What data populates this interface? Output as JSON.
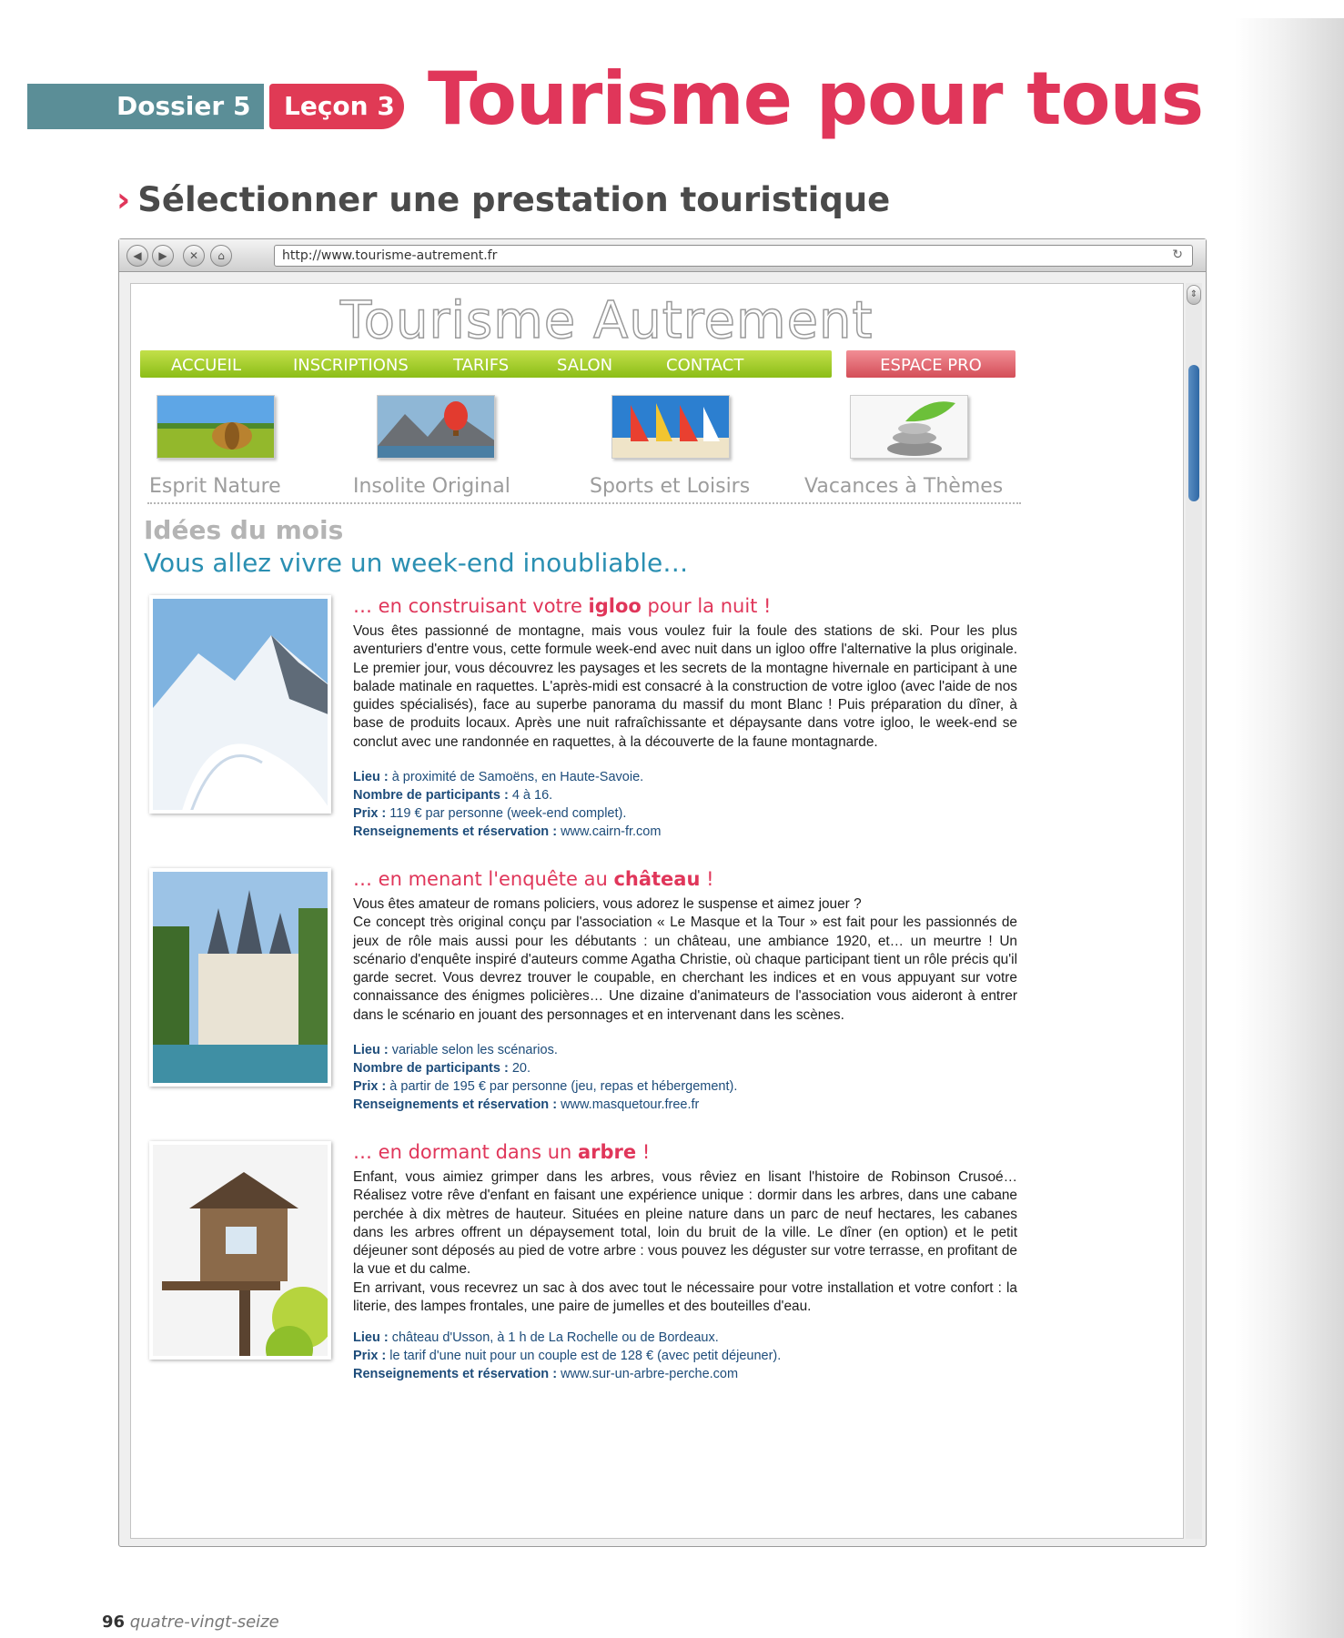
{
  "header": {
    "dossier_label": "Dossier",
    "dossier_num": "5",
    "lecon_label": "Leçon",
    "lecon_num": "3",
    "title": "Tourisme pour tous",
    "subtitle_marker": "›",
    "subtitle": "Sélectionner une prestation touristique"
  },
  "browser": {
    "url": "http://www.tourisme-autrement.fr",
    "back_icon": "back-arrow-icon",
    "forward_icon": "forward-arrow-icon",
    "stop_icon": "close-icon",
    "home_icon": "home-icon",
    "reload_icon": "reload-icon"
  },
  "site": {
    "logo": "Tourisme Autrement",
    "menu": [
      "ACCUEIL",
      "INSCRIPTIONS",
      "TARIFS",
      "SALON",
      "CONTACT"
    ],
    "pro_button": "ESPACE PRO",
    "categories": [
      "Esprit Nature",
      "Insolite Original",
      "Sports et Loisirs",
      "Vacances à Thèmes"
    ],
    "ideas_title": "Idées du mois",
    "ideas_heading": "Vous allez vivre un week-end inoubliable…"
  },
  "offers": [
    {
      "title_pre": "… en construisant votre ",
      "title_key": "igloo",
      "title_post": " pour la nuit !",
      "body": [
        "Vous êtes passionné de montagne, mais vous voulez fuir la foule des stations de ski. Pour les plus aventuriers d'entre vous, cette formule week-end avec nuit dans un igloo offre l'alternative la plus originale. Le premier jour, vous découvrez les paysages et les secrets de la montagne hivernale en participant à une balade matinale en raquettes. L'après-midi est consacré à la construction de votre igloo (avec l'aide de nos guides spécialisés), face au superbe panorama du massif du mont Blanc ! Puis préparation du dîner, à base de produits locaux. Après une nuit rafraîchissante et dépaysante dans votre igloo, le week-end se conclut avec une randonnée en raquettes, à la découverte de la faune montagnarde."
      ],
      "lieu_label": "Lieu :",
      "lieu": "à proximité de Samoëns, en Haute-Savoie.",
      "participants_label": "Nombre de participants :",
      "participants": "4 à 16.",
      "prix_label": "Prix :",
      "prix": "119 € par personne (week-end complet).",
      "resa_label": "Renseignements et réservation :",
      "resa": "www.cairn-fr.com"
    },
    {
      "title_pre": "… en menant l'enquête au ",
      "title_key": "château",
      "title_post": " !",
      "body": [
        "Vous êtes amateur de romans policiers, vous adorez le suspense et aimez jouer ?",
        "Ce concept très original conçu par l'association « Le Masque et la Tour » est fait pour les passionnés de jeux de rôle mais aussi pour les débutants : un château, une ambiance 1920, et… un meurtre ! Un scénario d'enquête inspiré d'auteurs comme Agatha Christie, où chaque participant tient un rôle précis qu'il garde secret. Vous devrez trouver le coupable, en cherchant les indices et en vous appuyant sur votre connaissance des énigmes policières… Une dizaine d'animateurs de l'association vous aideront à entrer dans le scénario en jouant des personnages et en intervenant dans les scènes."
      ],
      "lieu_label": "Lieu :",
      "lieu": "variable selon les scénarios.",
      "participants_label": "Nombre de participants :",
      "participants": "20.",
      "prix_label": "Prix :",
      "prix": "à partir de 195 € par personne (jeu, repas et hébergement).",
      "resa_label": "Renseignements et réservation :",
      "resa": "www.masquetour.free.fr"
    },
    {
      "title_pre": "… en dormant dans un ",
      "title_key": "arbre",
      "title_post": " !",
      "body": [
        "Enfant, vous aimiez grimper dans les arbres, vous rêviez en lisant l'histoire de Robinson Crusoé… Réalisez votre rêve d'enfant en faisant une expérience unique : dormir dans les arbres, dans une cabane perchée à dix mètres de hauteur. Situées en pleine nature dans un parc de neuf hectares, les cabanes dans les arbres offrent un dépaysement total, loin du bruit de la ville. Le dîner (en option) et le petit déjeuner sont déposés au pied de votre arbre : vous pouvez les déguster sur votre terrasse, en profitant de la vue et du calme.",
        "En arrivant, vous recevrez un sac à dos avec tout le nécessaire pour votre installation et votre confort : la literie, des lampes frontales, une paire de jumelles et des bouteilles d'eau."
      ],
      "lieu_label": "Lieu :",
      "lieu": "château d'Usson, à 1 h de La Rochelle ou de Bordeaux.",
      "prix_label": "Prix :",
      "prix": "le tarif d'une nuit pour un couple est de 128 € (avec petit déjeuner).",
      "resa_label": "Renseignements et réservation :",
      "resa": "www.sur-un-arbre-perche.com"
    }
  ],
  "footer": {
    "page_num": "96",
    "page_words": "quatre-vingt-seize"
  }
}
